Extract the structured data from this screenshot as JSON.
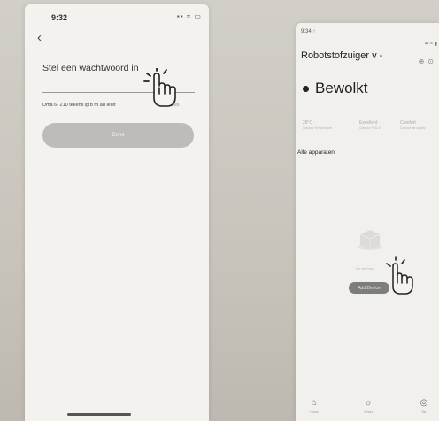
{
  "left_screen": {
    "status_time": "9:32",
    "status_icons": "▪▪ ≈ ▭",
    "back_glyph": "‹",
    "title": "Stel een wachtwoord in",
    "hint": "Uma 6- 210 tekens lp b rri ad lelet",
    "hint_right": "Ai kon lees",
    "done_label": "Done"
  },
  "right_screen": {
    "status_time": "9:34 ↑",
    "status_icons": "▪▪ ≈ ▮",
    "home_title": "Robotstofzuiger v",
    "home_title_caret": "-",
    "weather": "Bewolkt",
    "stats": [
      {
        "value": "28°C",
        "label": "Outdoor Temperature"
      },
      {
        "value": "Excellent",
        "label": "Outdoor PM2.5"
      },
      {
        "value": "Comfort",
        "label": "Outdoor air quality"
      }
    ],
    "all_devices": "Alle apparaten",
    "no_devices": "No devices",
    "add_device": "Add Device",
    "tabs": [
      {
        "icon": "home-icon",
        "label": "Home"
      },
      {
        "icon": "sun-icon",
        "label": "Smart"
      },
      {
        "icon": "me-icon",
        "label": "Me"
      }
    ]
  },
  "colors": {
    "background": "#c9c6bf",
    "screen": "#f3f2ee",
    "button_disabled": "#bdbcb8",
    "button_dark": "#7d7d7a"
  }
}
